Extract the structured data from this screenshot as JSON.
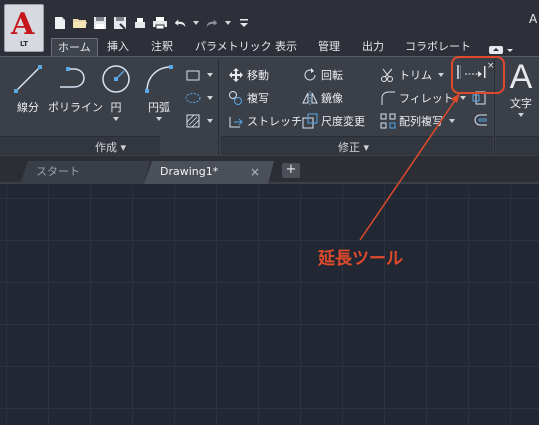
{
  "app": {
    "logo_letter": "A",
    "edition": "LT",
    "title_partial": "A"
  },
  "ribbon_tabs": [
    "ホーム",
    "挿入",
    "注釈",
    "パラメトリック",
    "表示",
    "管理",
    "出力",
    "コラボレート"
  ],
  "panels": {
    "create": {
      "title": "作成",
      "line": "線分",
      "polyline": "ポリライン",
      "circle": "円",
      "arc": "円弧"
    },
    "modify": {
      "title": "修正",
      "move": "移動",
      "rotate": "回転",
      "trim": "トリム",
      "copy": "複写",
      "mirror": "鏡像",
      "fillet": "フィレット",
      "stretch": "ストレッチ",
      "scale": "尺度変更",
      "array": "配列複写"
    },
    "annotation": {
      "text": "文字"
    }
  },
  "doc_tabs": {
    "start": "スタート",
    "drawing": "Drawing1*",
    "close_glyph": "×",
    "new_glyph": "+"
  },
  "extend_tool": {
    "close_glyph": "×"
  },
  "annotation": {
    "label": "延長ツール",
    "color": "#e04a2c"
  },
  "colors": {
    "canvas": "#222833",
    "ribbon": "#3b3f47",
    "app_red": "#c4161c"
  }
}
